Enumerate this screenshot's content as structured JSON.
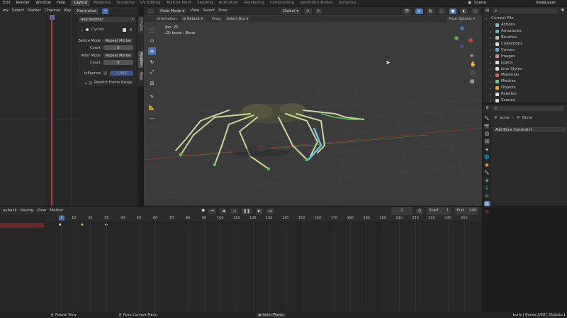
{
  "menu": [
    "Edit",
    "Render",
    "Window",
    "Help"
  ],
  "workspaces": [
    "Layout",
    "Modeling",
    "Sculpting",
    "UV Editing",
    "Texture Paint",
    "Shading",
    "Animation",
    "Rendering",
    "Compositing",
    "Geometry Nodes",
    "Scripting"
  ],
  "scene": {
    "label": "Scene",
    "view_layer": "ViewLayer"
  },
  "graph_header": {
    "items": [
      "ew",
      "Select",
      "Marker",
      "Channel",
      "Key"
    ],
    "normalize": "Normalize"
  },
  "modifier_panel": {
    "add_modifier": "Add Modifier",
    "name": "Cycles",
    "before_mode_label": "Before Mode",
    "before_mode": "Repeat Motion",
    "count_label": "Count",
    "count_before": "0",
    "after_mode_label": "After Mode",
    "after_mode": "Repeat Motion",
    "count_after": "0",
    "influence_label": "Influence",
    "influence": "1.000",
    "restrict": "Restrict Frame Range"
  },
  "side_tabs": [
    "F-Curve",
    "Modifiers",
    "View"
  ],
  "viewport": {
    "mode": "Pose Mode",
    "view": "View",
    "select": "Select",
    "pose": "Pose",
    "transform": "Global",
    "orientation_label": "Orientation:",
    "orientation": "Default",
    "drag_label": "Drag:",
    "drag": "Select Box",
    "pose_options": "Pose Options",
    "fps": "fps: 25",
    "object_info": "(2) bone : Bone"
  },
  "outliner": {
    "title": "Current File",
    "items": [
      "Actions",
      "Armatures",
      "Brushes",
      "Collections",
      "Curves",
      "Images",
      "Lights",
      "Line Styles",
      "Materials",
      "Meshes",
      "Objects",
      "Palettes",
      "Scenes"
    ]
  },
  "properties": {
    "crumb_obj": "bone",
    "crumb_bone": "Bone",
    "add_constraint": "Add Bone Constraint"
  },
  "timeline": {
    "header": [
      "ayback",
      "Keying",
      "View",
      "Marker"
    ],
    "current": "2",
    "start_label": "Start",
    "start": "1",
    "end_label": "End",
    "end": "240",
    "ticks": [
      "2",
      "10",
      "20",
      "30",
      "40",
      "50",
      "60",
      "70",
      "80",
      "90",
      "100",
      "110",
      "120",
      "130",
      "140",
      "150",
      "160",
      "170",
      "180",
      "190",
      "200",
      "210",
      "220",
      "230",
      "240",
      "250"
    ]
  },
  "statusbar": {
    "rotate": "Rotate View",
    "context": "Pose Context Menu",
    "anim": "Anim Player",
    "info": "bone | Bones:2/58 | Objects:1"
  },
  "colors": {
    "accent": "#4772b3",
    "bone_green": "#5ec15e",
    "bone_cyan": "#65c7e8",
    "timeline_red": "#b33a3a"
  }
}
